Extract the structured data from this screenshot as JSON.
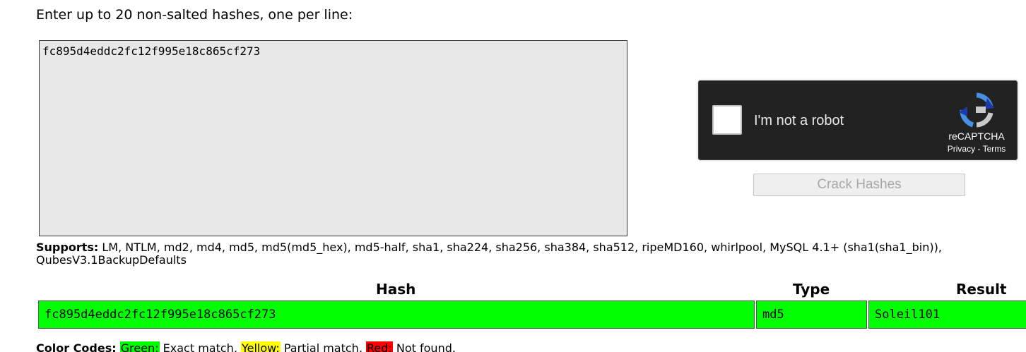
{
  "form": {
    "prompt": "Enter up to 20 non-salted hashes, one per line:",
    "hashes_value": "fc895d4eddc2fc12f995e18c865cf273",
    "crack_button_label": "Crack Hashes"
  },
  "recaptcha": {
    "checkbox_label": "I'm not a robot",
    "brand": "reCAPTCHA",
    "privacy_link": "Privacy",
    "separator": " - ",
    "terms_link": "Terms",
    "logo_icon": "recaptcha-logo-icon"
  },
  "supports": {
    "label": "Supports:",
    "list": " LM, NTLM, md2, md4, md5, md5(md5_hex), md5-half, sha1, sha224, sha256, sha384, sha512, ripeMD160, whirlpool, MySQL 4.1+ (sha1(sha1_bin)), QubesV3.1BackupDefaults"
  },
  "results": {
    "headers": {
      "hash": "Hash",
      "type": "Type",
      "result": "Result"
    },
    "rows": [
      {
        "hash": "fc895d4eddc2fc12f995e18c865cf273",
        "type": "md5",
        "result": "Soleil101",
        "status_color": "#00ff00"
      }
    ]
  },
  "color_codes": {
    "label": "Color Codes:",
    "green_label": "Green:",
    "green_text": " Exact match, ",
    "yellow_label": "Yellow:",
    "yellow_text": " Partial match, ",
    "red_label": "Red:",
    "red_text": " Not found.",
    "colors": {
      "green": "#00ff00",
      "yellow": "#ffff00",
      "red": "#ff0000"
    }
  }
}
